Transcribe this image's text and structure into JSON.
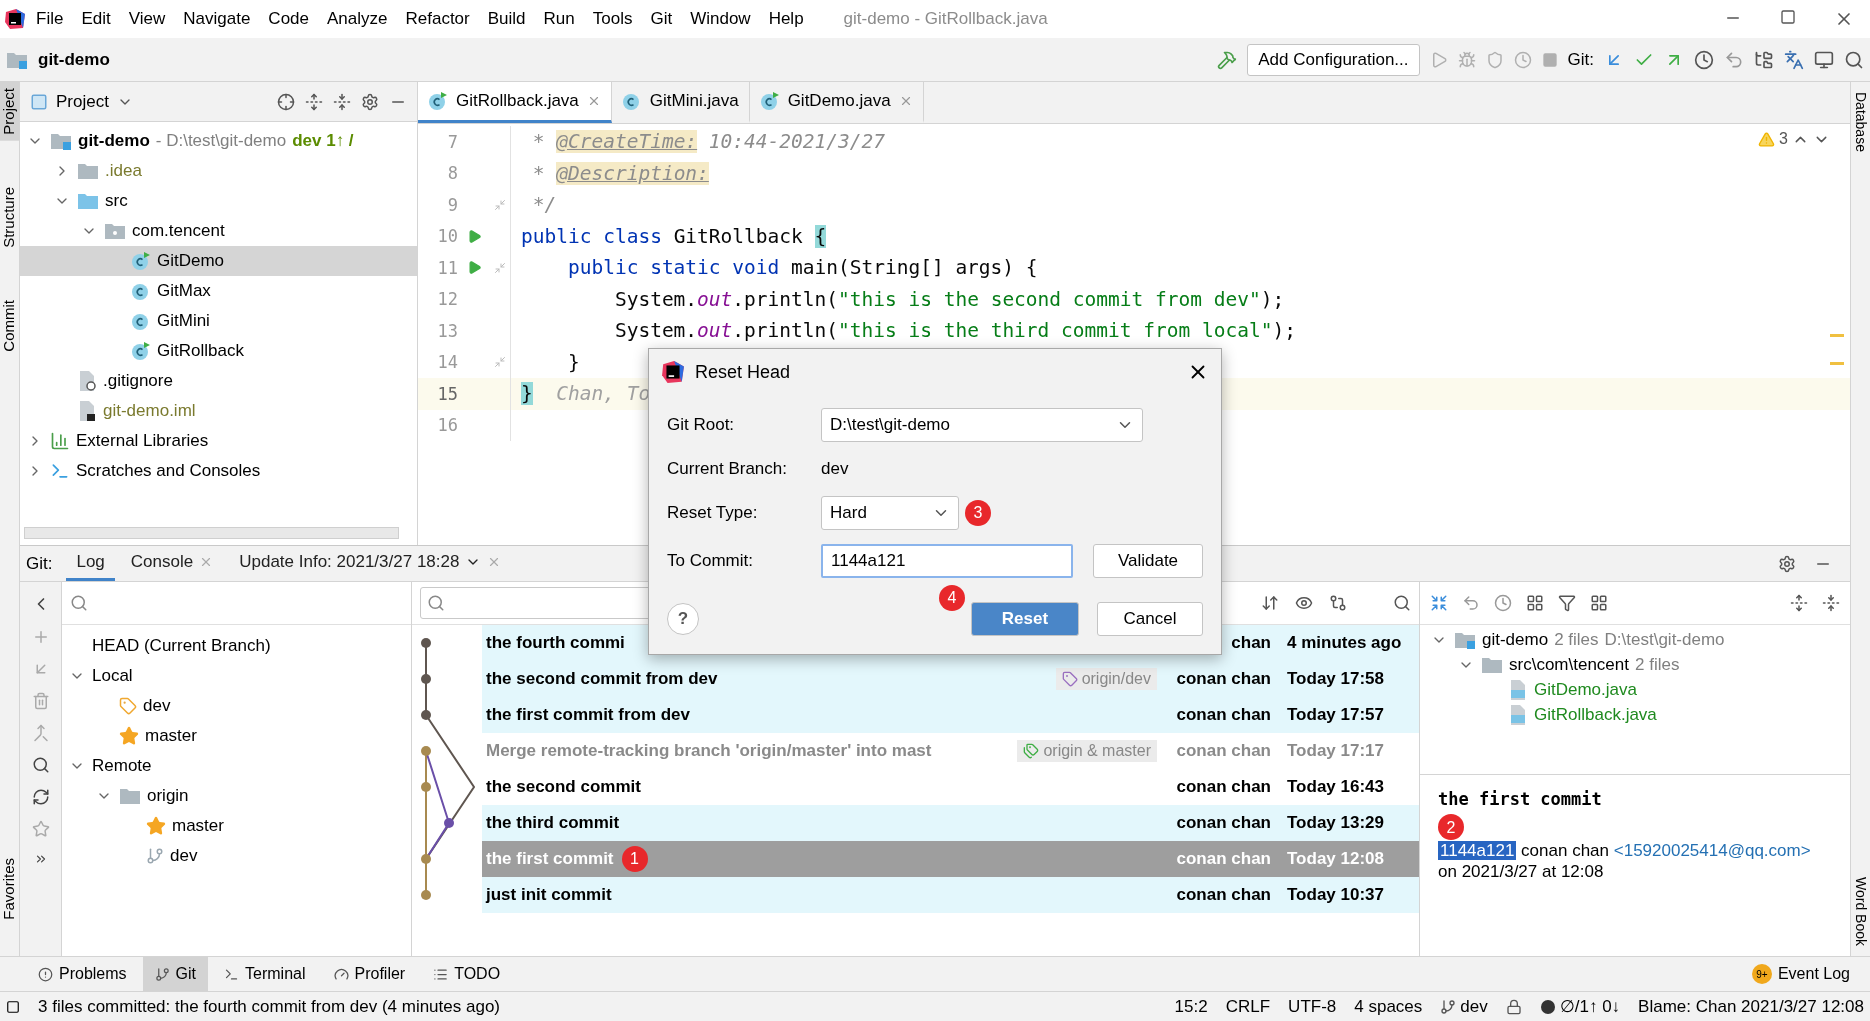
{
  "window": {
    "title": "git-demo - GitRollback.java"
  },
  "menu": [
    "File",
    "Edit",
    "View",
    "Navigate",
    "Code",
    "Analyze",
    "Refactor",
    "Build",
    "Run",
    "Tools",
    "Git",
    "Window",
    "Help"
  ],
  "navbar": {
    "project": "git-demo",
    "run_config": "Add Configuration...",
    "git_label": "Git:"
  },
  "left_strip": [
    {
      "label": "Project",
      "selected": true
    },
    {
      "label": "Structure",
      "selected": false
    },
    {
      "label": "Commit",
      "selected": false
    },
    {
      "label": "Favorites",
      "selected": false
    }
  ],
  "right_strip": [
    "Database",
    "Word Book"
  ],
  "project_panel": {
    "title": "Project",
    "tree": [
      {
        "label": "git-demo",
        "kind": "module",
        "expanded": true,
        "selected": false,
        "detail": "- D:\\test\\git-demo",
        "branch": "dev 1↑ /",
        "children": [
          {
            "label": ".idea",
            "kind": "folder",
            "expanded": false,
            "selected": false,
            "color": "#7a7a2e"
          },
          {
            "label": "src",
            "kind": "source",
            "expanded": true,
            "selected": false,
            "children": [
              {
                "label": "com.tencent",
                "kind": "package",
                "expanded": true,
                "selected": false,
                "children": [
                  {
                    "label": "GitDemo",
                    "kind": "runnable",
                    "selected": true
                  },
                  {
                    "label": "GitMax",
                    "kind": "class",
                    "selected": false
                  },
                  {
                    "label": "GitMini",
                    "kind": "class",
                    "selected": false
                  },
                  {
                    "label": "GitRollback",
                    "kind": "runnable",
                    "selected": false
                  }
                ]
              }
            ]
          },
          {
            "label": ".gitignore",
            "kind": "ignorefile",
            "selected": false
          },
          {
            "label": "git-demo.iml",
            "kind": "file",
            "selected": false,
            "color": "#7a7a2e"
          }
        ]
      },
      {
        "label": "External Libraries",
        "kind": "libraries",
        "expanded": false,
        "selected": false
      },
      {
        "label": "Scratches and Consoles",
        "kind": "scratches",
        "expanded": false,
        "selected": false
      }
    ]
  },
  "editor": {
    "tabs": [
      {
        "label": "GitRollback.java",
        "kind": "runnable",
        "selected": true,
        "closable": true
      },
      {
        "label": "GitMini.java",
        "kind": "class",
        "selected": false,
        "closable": false
      },
      {
        "label": "GitDemo.java",
        "kind": "runnable",
        "selected": false,
        "closable": true
      }
    ],
    "warnings": "3",
    "lines": [
      {
        "number": "7",
        "run": false,
        "fold": false,
        "current": false,
        "tokens": [
          {
            "text": " * ",
            "kind": "doc"
          },
          {
            "text": "@CreateTime:",
            "kind": "doctag"
          },
          {
            "text": " 10:44-2021/3/27",
            "kind": "doc"
          }
        ]
      },
      {
        "number": "8",
        "run": false,
        "fold": false,
        "current": false,
        "tokens": [
          {
            "text": " * ",
            "kind": "doc"
          },
          {
            "text": "@Description:",
            "kind": "doctag"
          }
        ]
      },
      {
        "number": "9",
        "run": false,
        "fold": true,
        "current": false,
        "tokens": [
          {
            "text": " */",
            "kind": "doc"
          }
        ]
      },
      {
        "number": "10",
        "run": true,
        "fold": false,
        "current": false,
        "tokens": [
          {
            "text": "public class",
            "kind": "keyword"
          },
          {
            "text": " GitRollback ",
            "kind": "plain"
          },
          {
            "text": "{",
            "kind": "brace"
          }
        ]
      },
      {
        "number": "11",
        "run": true,
        "fold": true,
        "current": false,
        "tokens": [
          {
            "text": "    public static void",
            "kind": "keyword"
          },
          {
            "text": " main(String[] args) {",
            "kind": "plain"
          }
        ]
      },
      {
        "number": "12",
        "run": false,
        "fold": false,
        "current": false,
        "tokens": [
          {
            "text": "        System.",
            "kind": "plain"
          },
          {
            "text": "out",
            "kind": "static"
          },
          {
            "text": ".println(",
            "kind": "plain"
          },
          {
            "text": "\"this is the second commit from dev\"",
            "kind": "string"
          },
          {
            "text": ");",
            "kind": "plain"
          }
        ]
      },
      {
        "number": "13",
        "run": false,
        "fold": false,
        "current": false,
        "tokens": [
          {
            "text": "        System.",
            "kind": "plain"
          },
          {
            "text": "out",
            "kind": "static"
          },
          {
            "text": ".println(",
            "kind": "plain"
          },
          {
            "text": "\"this is the third commit from local\"",
            "kind": "string"
          },
          {
            "text": ");",
            "kind": "plain"
          }
        ]
      },
      {
        "number": "14",
        "run": false,
        "fold": true,
        "current": false,
        "tokens": [
          {
            "text": "    }",
            "kind": "plain"
          }
        ]
      },
      {
        "number": "15",
        "run": false,
        "fold": false,
        "current": true,
        "tokens": [
          {
            "text": "}",
            "kind": "brace"
          },
          {
            "text": "  Chan, To",
            "kind": "hint"
          }
        ]
      },
      {
        "number": "16",
        "run": false,
        "fold": false,
        "current": false
      }
    ]
  },
  "git_panel": {
    "label": "Git:",
    "tabs": [
      {
        "label": "Log",
        "selected": true,
        "closable": false,
        "dropdown": false
      },
      {
        "label": "Console",
        "selected": false,
        "closable": true,
        "dropdown": false
      },
      {
        "label": "Update Info: 2021/3/27 18:28",
        "selected": false,
        "closable": true,
        "dropdown": true
      }
    ],
    "branches": [
      {
        "label": "HEAD (Current Branch)"
      },
      {
        "label": "Local",
        "expanded": true,
        "children": [
          {
            "label": "dev",
            "kind": "tag"
          },
          {
            "label": "master",
            "kind": "star"
          }
        ]
      },
      {
        "label": "Remote",
        "expanded": true,
        "children": [
          {
            "label": "origin",
            "kind": "folder",
            "expanded": true,
            "children": [
              {
                "label": "master",
                "kind": "star"
              },
              {
                "label": "dev",
                "kind": "branch"
              }
            ]
          }
        ]
      }
    ],
    "log": [
      {
        "subject": "the fourth  commi",
        "author": "chan",
        "date": "4 minutes ago",
        "highlighted": true,
        "dimmed": false,
        "selected": false
      },
      {
        "subject": "the second  commit from dev",
        "tag": {
          "label": "origin/dev",
          "kind": "single"
        },
        "author": "conan chan",
        "date": "Today 17:58",
        "highlighted": true,
        "dimmed": false,
        "selected": false
      },
      {
        "subject": "the first  commit from dev",
        "author": "conan chan",
        "date": "Today 17:57",
        "highlighted": true,
        "dimmed": false,
        "selected": false
      },
      {
        "subject": "Merge remote-tracking branch 'origin/master' into mast",
        "tag": {
          "label": "origin & master",
          "kind": "double"
        },
        "author": "conan chan",
        "date": "Today 17:17",
        "highlighted": false,
        "dimmed": true,
        "selected": false
      },
      {
        "subject": "the second commit",
        "author": "conan chan",
        "date": "Today 16:43",
        "highlighted": false,
        "dimmed": false,
        "selected": false
      },
      {
        "subject": "the third commit",
        "author": "conan chan",
        "date": "Today 13:29",
        "highlighted": true,
        "dimmed": false,
        "selected": false
      },
      {
        "subject": "the first commit",
        "author": "conan chan",
        "date": "Today 12:08",
        "highlighted": true,
        "dimmed": false,
        "selected": true,
        "marker": "1"
      },
      {
        "subject": "just init commit",
        "author": "conan chan",
        "date": "Today 10:37",
        "highlighted": true,
        "dimmed": false,
        "selected": false
      }
    ],
    "changes": [
      {
        "label": "git-demo",
        "count": "2 files",
        "path": "D:\\test\\git-demo",
        "kind": "module",
        "children": [
          {
            "label": "src\\com\\tencent",
            "count": "2 files",
            "kind": "folder",
            "children": [
              {
                "label": "GitDemo.java",
                "kind": "file"
              },
              {
                "label": "GitRollback.java",
                "kind": "file"
              }
            ]
          }
        ]
      }
    ],
    "details": {
      "message": "the first commit",
      "hash": "1144a121",
      "author": "conan chan",
      "email": "<15920025414@qq.com>",
      "when": "on 2021/3/27 at 12:08",
      "marker": "2"
    }
  },
  "dialog": {
    "title": "Reset Head",
    "git_root_label": "Git Root:",
    "git_root": "D:\\test\\git-demo",
    "branch_label": "Current Branch:",
    "branch": "dev",
    "reset_type_label": "Reset Type:",
    "reset_type": "Hard",
    "reset_type_marker": "3",
    "commit_label": "To Commit:",
    "commit": "1144a121",
    "commit_marker": "4",
    "validate": "Validate",
    "ok": "Reset",
    "cancel": "Cancel",
    "help": "?"
  },
  "tool_buttons": [
    {
      "label": "Problems",
      "kind": "problems",
      "selected": false
    },
    {
      "label": "Git",
      "kind": "git",
      "selected": true
    },
    {
      "label": "Terminal",
      "kind": "terminal",
      "selected": false
    },
    {
      "label": "Profiler",
      "kind": "profiler",
      "selected": false
    },
    {
      "label": "TODO",
      "kind": "todo",
      "selected": false
    }
  ],
  "event_log": {
    "label": "Event Log",
    "badge": "9+"
  },
  "status_bar": {
    "message": "3 files committed: the fourth  commit from dev (4 minutes ago)",
    "position": "15:2",
    "line_sep": "CRLF",
    "encoding": "UTF-8",
    "indent": "4 spaces",
    "branch": "dev",
    "sync": "∅/1↑ 0↓",
    "blame": "Blame: Chan 2021/3/27 12:08"
  }
}
